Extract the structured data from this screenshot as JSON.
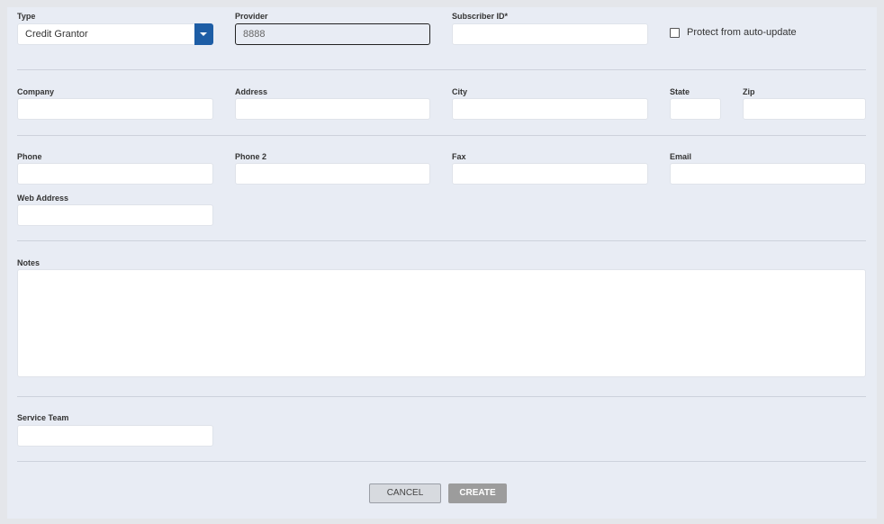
{
  "form": {
    "type": {
      "label": "Type",
      "value": "Credit Grantor"
    },
    "provider": {
      "label": "Provider",
      "value": "8888"
    },
    "subscriber_id": {
      "label": "Subscriber ID*",
      "value": ""
    },
    "protect": {
      "label": "Protect from auto-update",
      "checked": false
    },
    "company": {
      "label": "Company",
      "value": ""
    },
    "address": {
      "label": "Address",
      "value": ""
    },
    "city": {
      "label": "City",
      "value": ""
    },
    "state": {
      "label": "State",
      "value": ""
    },
    "zip": {
      "label": "Zip",
      "value": ""
    },
    "phone": {
      "label": "Phone",
      "value": ""
    },
    "phone2": {
      "label": "Phone 2",
      "value": ""
    },
    "fax": {
      "label": "Fax",
      "value": ""
    },
    "email": {
      "label": "Email",
      "value": ""
    },
    "web_address": {
      "label": "Web Address",
      "value": ""
    },
    "notes": {
      "label": "Notes",
      "value": ""
    },
    "service_team": {
      "label": "Service Team",
      "value": ""
    }
  },
  "actions": {
    "cancel_label": "CANCEL",
    "create_label": "CREATE"
  },
  "colors": {
    "accent": "#1d5da5",
    "panel_bg": "#e8ecf4",
    "disabled_button": "#9c9c9c"
  },
  "icons": {
    "type_dropdown": "caret-down-icon",
    "protect_checkbox": "checkbox-icon"
  }
}
